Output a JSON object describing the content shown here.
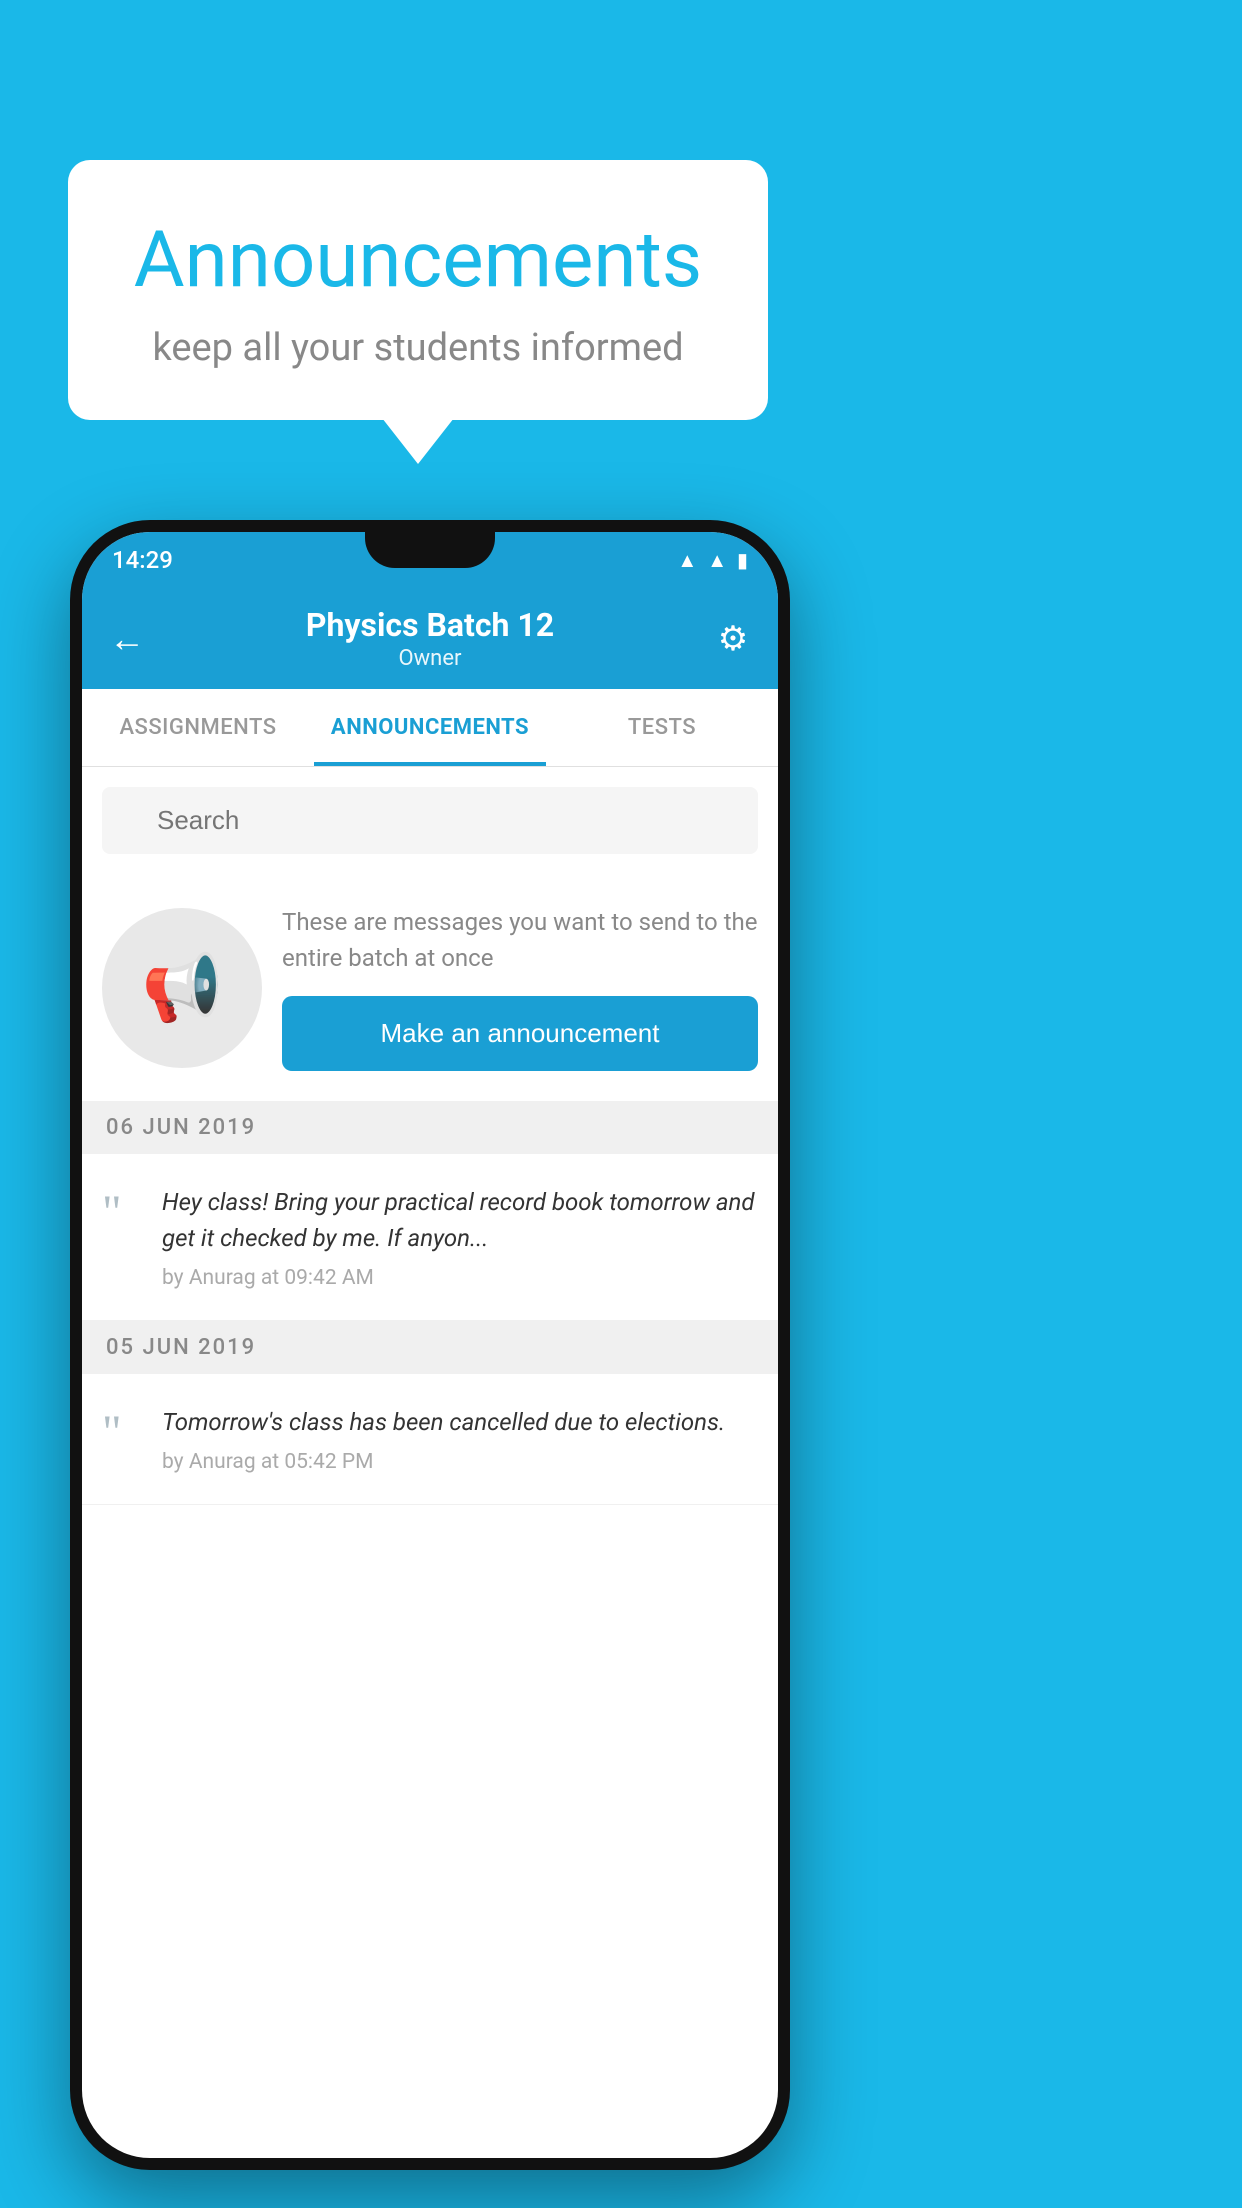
{
  "background_color": "#1ab8e8",
  "speech_bubble": {
    "title": "Announcements",
    "subtitle": "keep all your students informed"
  },
  "phone": {
    "status_bar": {
      "time": "14:29",
      "icons": [
        "wifi",
        "signal",
        "battery"
      ]
    },
    "header": {
      "title": "Physics Batch 12",
      "subtitle": "Owner",
      "back_label": "←",
      "gear_label": "⚙"
    },
    "tabs": [
      {
        "label": "ASSIGNMENTS",
        "active": false
      },
      {
        "label": "ANNOUNCEMENTS",
        "active": true
      },
      {
        "label": "TESTS",
        "active": false
      }
    ],
    "search": {
      "placeholder": "Search"
    },
    "announcement_prompt": {
      "description": "These are messages you want to send to the entire batch at once",
      "button_label": "Make an announcement"
    },
    "announcement_items": [
      {
        "date": "06  JUN  2019",
        "text": "Hey class! Bring your practical record book tomorrow and get it checked by me. If anyon...",
        "meta": "by Anurag at 09:42 AM"
      },
      {
        "date": "05  JUN  2019",
        "text": "Tomorrow's class has been cancelled due to elections.",
        "meta": "by Anurag at 05:42 PM"
      }
    ]
  }
}
